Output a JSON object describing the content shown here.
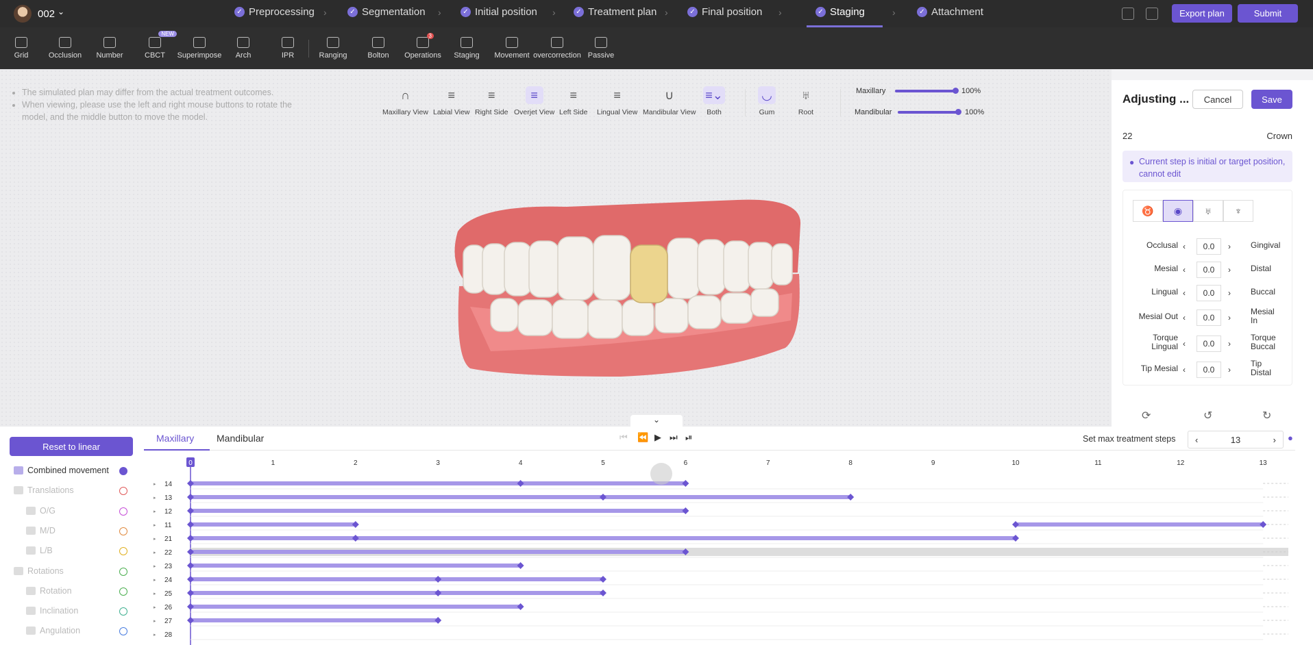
{
  "header": {
    "case_id": "002",
    "export_label": "Export plan",
    "submit_label": "Submit",
    "steps": [
      "Preprocessing",
      "Segmentation",
      "Initial position",
      "Treatment plan",
      "Final position",
      "Staging",
      "Attachment"
    ],
    "active_step": "Staging"
  },
  "toolbar": {
    "items": [
      "Grid",
      "Occlusion",
      "Number",
      "CBCT",
      "Superimpose",
      "Arch",
      "IPR",
      "Ranging",
      "Bolton",
      "Operations",
      "Staging",
      "Movement",
      "overcorrection",
      "Passive"
    ],
    "new_badge": "NEW",
    "operations_badge": "3"
  },
  "notes": [
    "The simulated plan may differ from the actual treatment outcomes.",
    "When viewing, please use the left and right mouse buttons to rotate the model, and the middle button to move the model."
  ],
  "views": [
    "Maxillary View",
    "Labial View",
    "Right Side",
    "Overjet View",
    "Left Side",
    "Lingual View",
    "Mandibular View",
    "Both",
    "Gum",
    "Root"
  ],
  "opacity": {
    "maxillary_label": "Maxillary",
    "maxillary_value": "100%",
    "mandibular_label": "Mandibular",
    "mandibular_value": "100%"
  },
  "panel": {
    "title": "Adjusting ...",
    "cancel": "Cancel",
    "save": "Save",
    "tooth": "22",
    "mode": "Crown",
    "info": "Current step is initial or target position, cannot edit",
    "rows": [
      {
        "left": "Occlusal",
        "value": "0.0",
        "right": "Gingival"
      },
      {
        "left": "Mesial",
        "value": "0.0",
        "right": "Distal"
      },
      {
        "left": "Lingual",
        "value": "0.0",
        "right": "Buccal"
      },
      {
        "left": "Mesial Out",
        "value": "0.0",
        "right": "Mesial In"
      },
      {
        "left": "Torque Lingual",
        "value": "0.0",
        "right": "Torque Buccal"
      },
      {
        "left": "Tip Mesial",
        "value": "0.0",
        "right": "Tip Distal"
      }
    ]
  },
  "timeline": {
    "reset_label": "Reset to linear",
    "tab_max": "Maxillary",
    "tab_mand": "Mandibular",
    "max_steps_label": "Set max treatment steps",
    "max_steps": "13",
    "movements": [
      {
        "label": "Combined movement",
        "color": "#6b55d1",
        "level": 0,
        "active": true
      },
      {
        "label": "Translations",
        "color": "#e05a5a",
        "level": 0
      },
      {
        "label": "O/G",
        "color": "#c64fd8",
        "level": 1
      },
      {
        "label": "M/D",
        "color": "#e08a40",
        "level": 1
      },
      {
        "label": "L/B",
        "color": "#e0b020",
        "level": 1
      },
      {
        "label": "Rotations",
        "color": "#4caf50",
        "level": 0
      },
      {
        "label": "Rotation",
        "color": "#4caf50",
        "level": 1
      },
      {
        "label": "Inclination",
        "color": "#40b090",
        "level": 1
      },
      {
        "label": "Angulation",
        "color": "#4a7de0",
        "level": 1
      }
    ],
    "step_numbers": [
      "0",
      "1",
      "2",
      "3",
      "4",
      "5",
      "6",
      "7",
      "8",
      "9",
      "10",
      "11",
      "12",
      "13"
    ],
    "teeth": [
      {
        "id": "14",
        "segments": [
          [
            0,
            6
          ]
        ],
        "nodes": [
          0,
          4,
          6
        ]
      },
      {
        "id": "13",
        "segments": [
          [
            0,
            8
          ]
        ],
        "nodes": [
          0,
          5,
          8
        ]
      },
      {
        "id": "12",
        "segments": [
          [
            0,
            6
          ]
        ],
        "nodes": [
          0,
          6
        ]
      },
      {
        "id": "11",
        "segments": [
          [
            0,
            2
          ],
          [
            10,
            13
          ]
        ],
        "nodes": [
          0,
          2,
          10,
          13
        ]
      },
      {
        "id": "21",
        "segments": [
          [
            0,
            10
          ]
        ],
        "nodes": [
          0,
          2,
          10
        ]
      },
      {
        "id": "22",
        "segments": [
          [
            0,
            6
          ]
        ],
        "nodes": [
          0,
          6
        ],
        "selected": true
      },
      {
        "id": "23",
        "segments": [
          [
            0,
            4
          ]
        ],
        "nodes": [
          0,
          4
        ]
      },
      {
        "id": "24",
        "segments": [
          [
            0,
            5
          ]
        ],
        "nodes": [
          0,
          3,
          5
        ]
      },
      {
        "id": "25",
        "segments": [
          [
            0,
            5
          ]
        ],
        "nodes": [
          0,
          3,
          5
        ]
      },
      {
        "id": "26",
        "segments": [
          [
            0,
            4
          ]
        ],
        "nodes": [
          0,
          4
        ]
      },
      {
        "id": "27",
        "segments": [
          [
            0,
            3
          ]
        ],
        "nodes": [
          0,
          3
        ]
      },
      {
        "id": "28",
        "segments": [],
        "nodes": []
      }
    ]
  }
}
